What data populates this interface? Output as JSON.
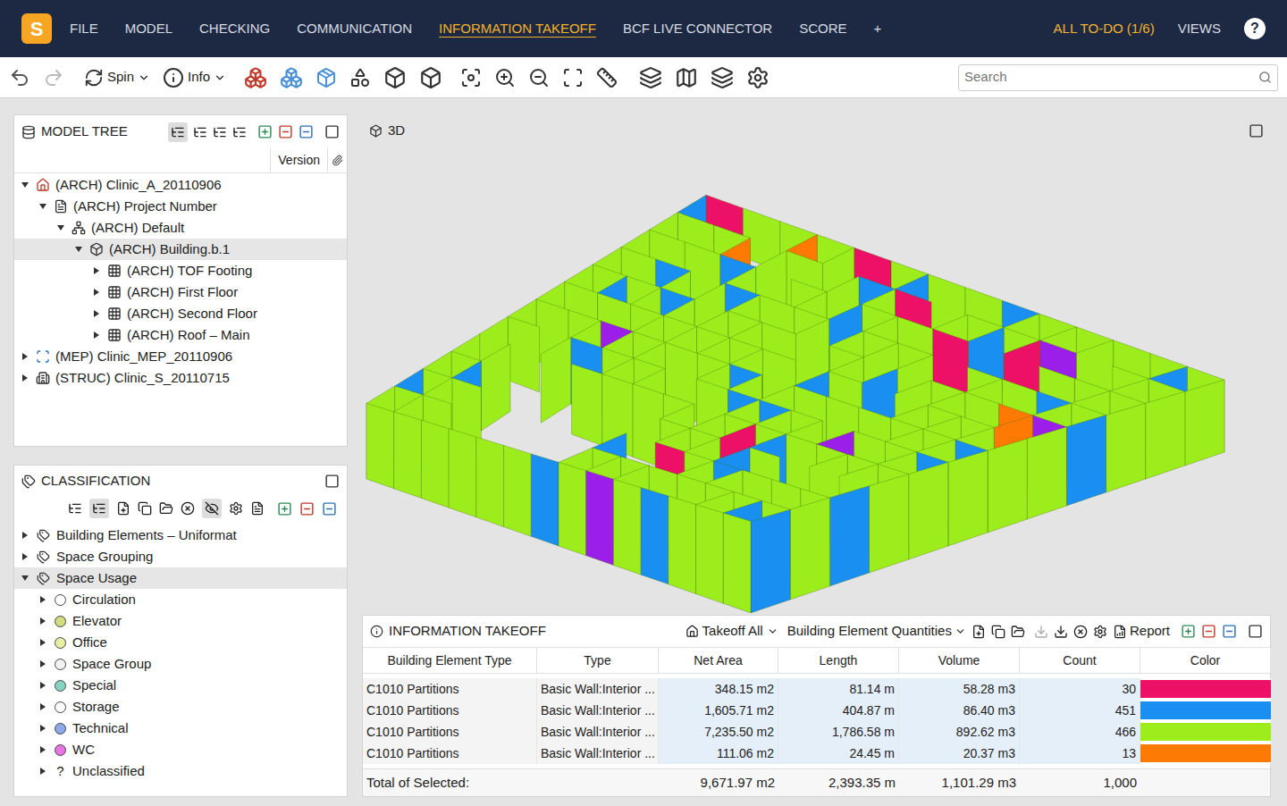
{
  "menu": {
    "logo": "S",
    "items": [
      {
        "label": "FILE",
        "selected": false
      },
      {
        "label": "MODEL",
        "selected": false
      },
      {
        "label": "CHECKING",
        "selected": false
      },
      {
        "label": "COMMUNICATION",
        "selected": false
      },
      {
        "label": "INFORMATION TAKEOFF",
        "selected": true
      },
      {
        "label": "BCF LIVE CONNECTOR",
        "selected": false
      },
      {
        "label": "SCORE",
        "selected": false
      },
      {
        "label": "+",
        "selected": false
      }
    ],
    "todo": "ALL TO-DO (1/6)",
    "views": "VIEWS",
    "help": "?"
  },
  "toolbar": {
    "spin": "Spin",
    "info": "Info",
    "search_placeholder": "Search"
  },
  "model_tree": {
    "title": "MODEL TREE",
    "column": "Version",
    "items": [
      {
        "label": "(ARCH) Clinic_A_20110906",
        "kind": "model",
        "depth": 0,
        "expanded": true,
        "selected": false
      },
      {
        "label": "(ARCH) Project Number",
        "kind": "project",
        "depth": 1,
        "expanded": true,
        "selected": false
      },
      {
        "label": "(ARCH) Default",
        "kind": "site",
        "depth": 2,
        "expanded": true,
        "selected": false
      },
      {
        "label": "(ARCH) Building.b.1",
        "kind": "building",
        "depth": 3,
        "expanded": true,
        "selected": true
      },
      {
        "label": "(ARCH) TOF Footing",
        "kind": "storey",
        "depth": 4,
        "expanded": false,
        "selected": false
      },
      {
        "label": "(ARCH) First Floor",
        "kind": "storey",
        "depth": 4,
        "expanded": false,
        "selected": false
      },
      {
        "label": "(ARCH) Second Floor",
        "kind": "storey",
        "depth": 4,
        "expanded": false,
        "selected": false
      },
      {
        "label": "(ARCH) Roof – Main",
        "kind": "storey",
        "depth": 4,
        "expanded": false,
        "selected": false
      },
      {
        "label": "(MEP) Clinic_MEP_20110906",
        "kind": "model-mep",
        "depth": 0,
        "expanded": false,
        "selected": false
      },
      {
        "label": "(STRUC) Clinic_S_20110715",
        "kind": "model-struc",
        "depth": 0,
        "expanded": false,
        "selected": false
      }
    ]
  },
  "classification": {
    "title": "CLASSIFICATION",
    "items": [
      {
        "label": "Building Elements – Uniformat",
        "kind": "group",
        "depth": 0,
        "expanded": false,
        "selected": false
      },
      {
        "label": "Space Grouping",
        "kind": "group",
        "depth": 0,
        "expanded": false,
        "selected": false
      },
      {
        "label": "Space Usage",
        "kind": "group",
        "depth": 0,
        "expanded": true,
        "selected": true
      },
      {
        "label": "Circulation",
        "kind": "space",
        "depth": 1,
        "expanded": false,
        "selected": false,
        "color": "#ffffff"
      },
      {
        "label": "Elevator",
        "kind": "space",
        "depth": 1,
        "expanded": false,
        "selected": false,
        "color": "#d3dc7e"
      },
      {
        "label": "Office",
        "kind": "space",
        "depth": 1,
        "expanded": false,
        "selected": false,
        "color": "#e7eea6"
      },
      {
        "label": "Space Group",
        "kind": "space",
        "depth": 1,
        "expanded": false,
        "selected": false,
        "color": "#f2f2f2"
      },
      {
        "label": "Special",
        "kind": "space",
        "depth": 1,
        "expanded": false,
        "selected": false,
        "color": "#86d3c4"
      },
      {
        "label": "Storage",
        "kind": "space",
        "depth": 1,
        "expanded": false,
        "selected": false,
        "color": "#ffffff"
      },
      {
        "label": "Technical",
        "kind": "space",
        "depth": 1,
        "expanded": false,
        "selected": false,
        "color": "#8fa9e8"
      },
      {
        "label": "WC",
        "kind": "space",
        "depth": 1,
        "expanded": false,
        "selected": false,
        "color": "#e776e4"
      },
      {
        "label": "Unclassified",
        "kind": "unknown",
        "depth": 1,
        "expanded": false,
        "selected": false,
        "icon": "?"
      }
    ]
  },
  "view3d": {
    "title": "3D"
  },
  "takeoff": {
    "title": "INFORMATION TAKEOFF",
    "takeoff_all": "Takeoff All",
    "definition": "Building Element Quantities",
    "report": "Report",
    "columns": [
      "Building Element Type",
      "Type",
      "Net Area",
      "Length",
      "Volume",
      "Count",
      "Color"
    ],
    "rows": [
      {
        "element_type": "C1010 Partitions",
        "type": "Basic Wall:Interior ...",
        "net_area": "348.15 m2",
        "length": "81.14 m",
        "volume": "58.28 m3",
        "count": "30",
        "color": "#ec1166"
      },
      {
        "element_type": "C1010 Partitions",
        "type": "Basic Wall:Interior ...",
        "net_area": "1,605.71 m2",
        "length": "404.87 m",
        "volume": "86.40 m3",
        "count": "451",
        "color": "#1a8ff2"
      },
      {
        "element_type": "C1010 Partitions",
        "type": "Basic Wall:Interior ...",
        "net_area": "7,235.50 m2",
        "length": "1,786.58 m",
        "volume": "892.62 m3",
        "count": "466",
        "color": "#9ded1c"
      },
      {
        "element_type": "C1010 Partitions",
        "type": "Basic Wall:Interior ...",
        "net_area": "111.06 m2",
        "length": "24.45 m",
        "volume": "20.37 m3",
        "count": "13",
        "color": "#ff7a05"
      }
    ],
    "total": {
      "label": "Total of Selected:",
      "net_area": "9,671.97 m2",
      "length": "2,393.35 m",
      "volume": "1,101.29 m3",
      "count": "1,000"
    }
  }
}
